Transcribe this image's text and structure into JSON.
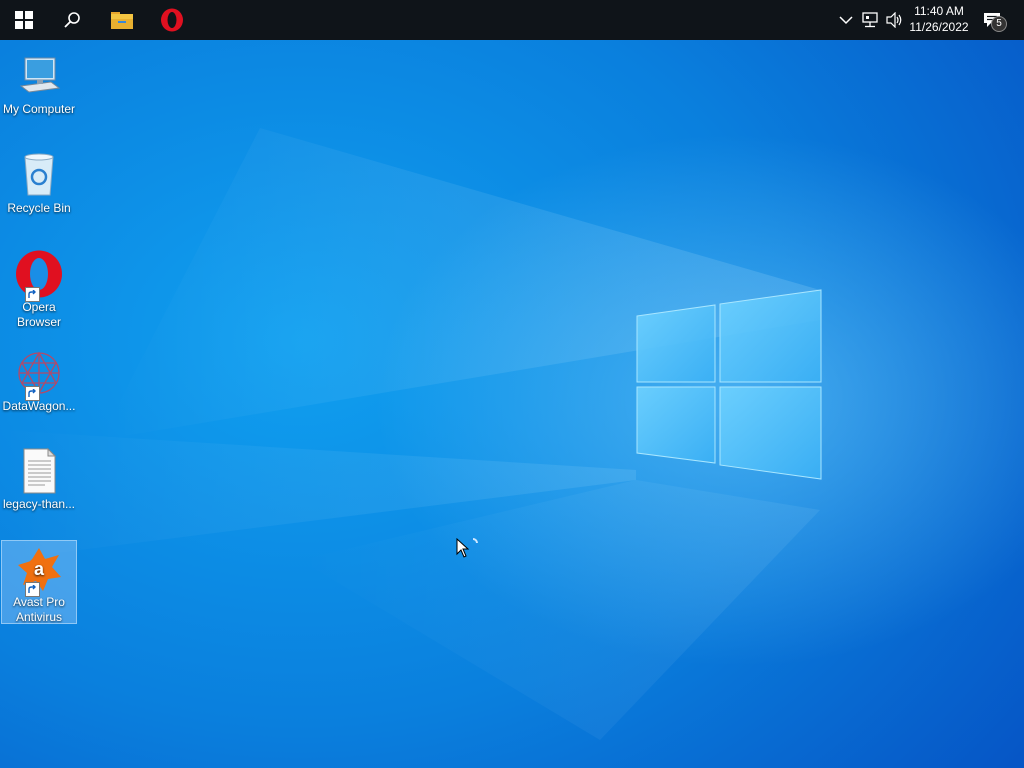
{
  "taskbar": {
    "pinned": [
      {
        "name": "start-button-icon"
      },
      {
        "name": "search-icon"
      },
      {
        "name": "file-explorer-icon"
      },
      {
        "name": "opera-icon"
      }
    ],
    "tray": {
      "chevron": "chevron-up-icon",
      "network": "network-icon",
      "volume": "volume-icon"
    },
    "clock": {
      "time": "11:40 AM",
      "date": "11/26/2022"
    },
    "notifications": {
      "count": "5"
    }
  },
  "desktop": {
    "icons": [
      {
        "label": "My Computer"
      },
      {
        "label": "Recycle Bin"
      },
      {
        "label": "Opera Browser"
      },
      {
        "label": "DataWagon..."
      },
      {
        "label": "legacy-than..."
      },
      {
        "label": "Avast Pro Antivirus"
      }
    ]
  },
  "colors": {
    "taskbar_bg": "#0f1419",
    "wallpaper_primary": "#0a7fdd",
    "opera_red": "#e01020",
    "avast_orange": "#f07010"
  }
}
